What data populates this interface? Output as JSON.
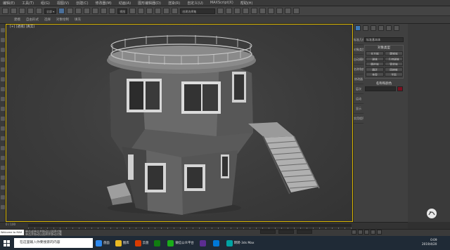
{
  "menubar": {
    "items": [
      "编辑(E)",
      "工具(T)",
      "组(G)",
      "视图(V)",
      "创建(C)",
      "修改器(M)",
      "动画(A)",
      "图形编辑器(D)",
      "渲染(R)",
      "自定义(U)",
      "MAXScript(X)",
      "帮助(H)"
    ]
  },
  "toolbar": {
    "view_dropdown": "视图",
    "selection_set": "创建选择集"
  },
  "toolbar2": {
    "items": [
      "建模",
      "自由形式",
      "选择",
      "对象绘制",
      "填充"
    ]
  },
  "viewport": {
    "label": "[+] [透视] [真实]"
  },
  "command_panel": {
    "side_labels": [
      "标准几何体",
      "对象类型",
      "自动栅格",
      "名称和颜色",
      "修改器",
      "层次",
      "运动",
      "显示",
      "实用程序"
    ],
    "dropdown": "标准基本体",
    "object_type_title": "对象类型",
    "object_buttons": [
      "长方体",
      "圆锥体",
      "球体",
      "几何球体",
      "圆柱体",
      "管状体",
      "圆环",
      "四棱锥",
      "茶壶",
      "平面"
    ],
    "name_color_title": "名称和颜色",
    "swatch_color": "#7a1020"
  },
  "timeline": {
    "frame": "0 / 100"
  },
  "status": {
    "maxscript": "Welcome to MAX",
    "line1": "单击或单击并拖动以选择对象",
    "line2": "单击并拖动以选择并移动对象"
  },
  "taskbar": {
    "search_placeholder": "在这里输入你要搜索的内容",
    "apps": [
      {
        "label": "盘面",
        "color": "#2d89ef"
      },
      {
        "label": "图库",
        "color": "#e8b923"
      },
      {
        "label": "云盘",
        "color": "#d83b01"
      },
      {
        "label": "",
        "color": "#107c10"
      },
      {
        "label": "微信公众平台",
        "color": "#1aad19"
      },
      {
        "label": "",
        "color": "#5c2d91"
      },
      {
        "label": "",
        "color": "#0078d7"
      },
      {
        "label": "转转-3ds Max",
        "color": "#00a3a3"
      }
    ],
    "time": "0:09",
    "date": "2019/4/20"
  }
}
